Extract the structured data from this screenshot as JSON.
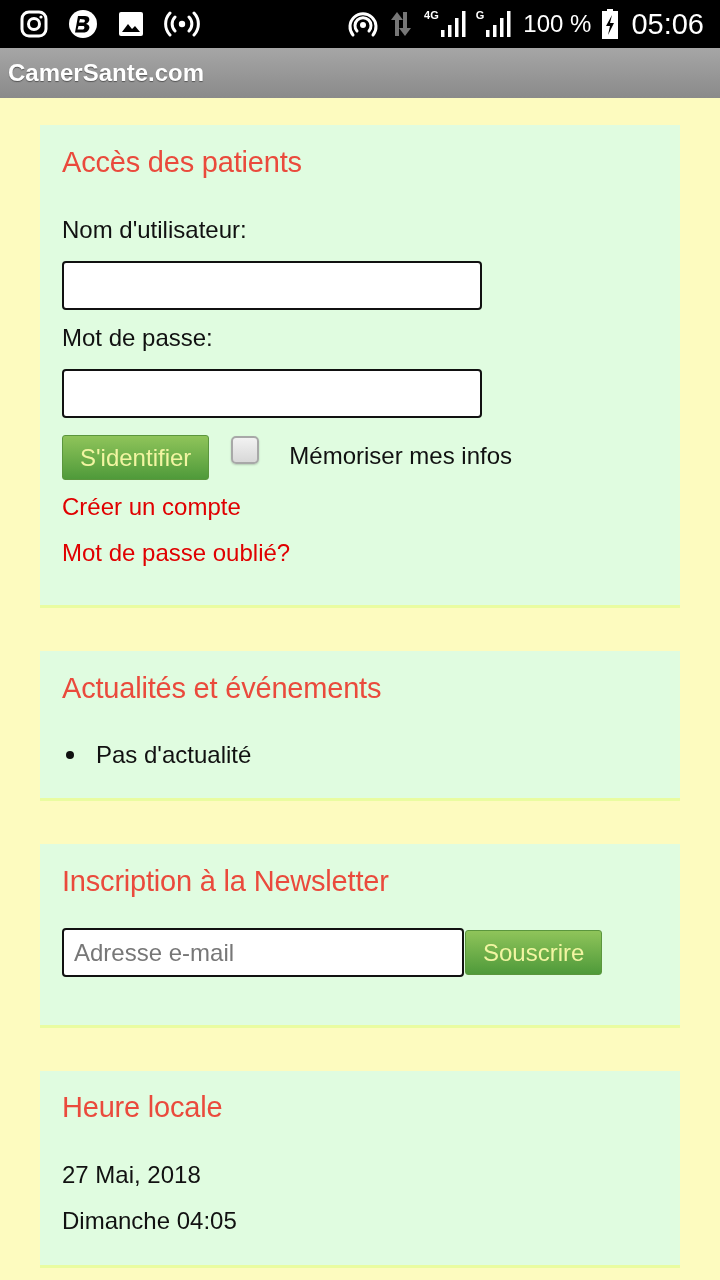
{
  "status_bar": {
    "signals": [
      {
        "label": "4G"
      },
      {
        "label": "G"
      }
    ],
    "battery": "100 %",
    "time": "05:06"
  },
  "app_bar": {
    "title": "CamerSante.com"
  },
  "login": {
    "title": "Accès des patients",
    "fields": [
      {
        "label": "Nom d'utilisateur:"
      },
      {
        "label": "Mot de passe:"
      }
    ],
    "submit": "S'identifier",
    "remember": {
      "label": "Mémoriser mes infos",
      "checked": false
    },
    "links": [
      "Créer un compte",
      "Mot de passe oublié?"
    ]
  },
  "news": {
    "title": "Actualités et événements",
    "items": [
      "Pas d'actualité"
    ]
  },
  "newsletter": {
    "title": "Inscription à la Newsletter",
    "email": {
      "placeholder": "Adresse e-mail"
    },
    "button": "Souscrire"
  },
  "clock": {
    "title": "Heure locale",
    "lines": [
      "27 Mai, 2018",
      "Dimanche 04:05"
    ]
  }
}
